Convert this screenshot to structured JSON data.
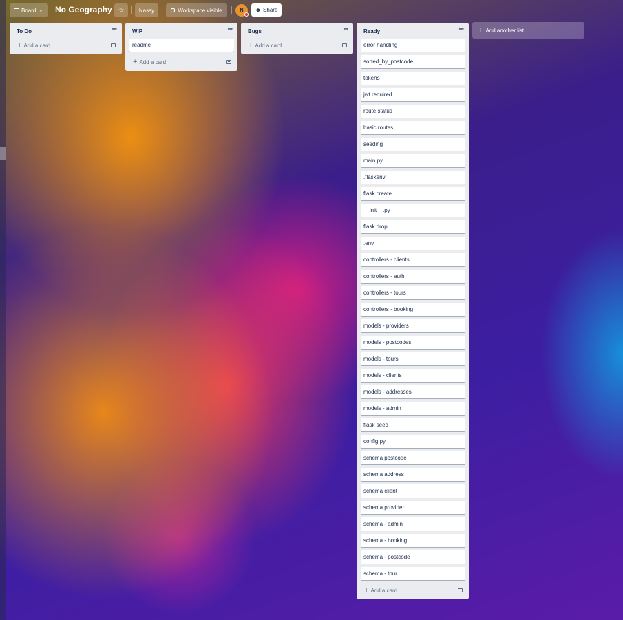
{
  "header": {
    "board_label": "Board",
    "title": "No Geography",
    "workspace_label": "Nassy",
    "visibility_label": "Workspace visible",
    "avatar_initial": "N",
    "share_label": "Share"
  },
  "lists": [
    {
      "title": "To Do",
      "cards": [],
      "add_card_label": "Add a card"
    },
    {
      "title": "WIP",
      "cards": [
        "readme"
      ],
      "add_card_label": "Add a card"
    },
    {
      "title": "Bugs",
      "cards": [],
      "add_card_label": "Add a card"
    },
    {
      "title": "Ready",
      "cards": [
        "error handling",
        "sorted_by_postcode",
        "tokens",
        "jwt required",
        "route status",
        "basic routes",
        "seeding",
        "main.py",
        ".flaskenv",
        "flask create",
        "__init__.py",
        "flask drop",
        ".env",
        "controllers - clients",
        "controllers - auth",
        "controllers - tours",
        "controllers - booking",
        "models - providers",
        "models - postcodes",
        "models - tours",
        "models - clients",
        "models - addresses",
        "models - admin",
        "flask seed",
        "config.py",
        "schema postcode",
        "schema address",
        "schema client",
        "schema provider",
        "schema - admin",
        "schema - booking",
        "schema - postcode",
        "schema - tour"
      ],
      "add_card_label": "Add a card"
    }
  ],
  "add_list_label": "Add another list",
  "icons": {
    "board": "board-icon",
    "chevron": "chevron-down-icon",
    "star": "star-icon",
    "lock": "lock-icon",
    "share": "person-add-icon",
    "more": "more-horizontal-icon",
    "plus": "plus-icon",
    "template": "card-template-icon"
  }
}
